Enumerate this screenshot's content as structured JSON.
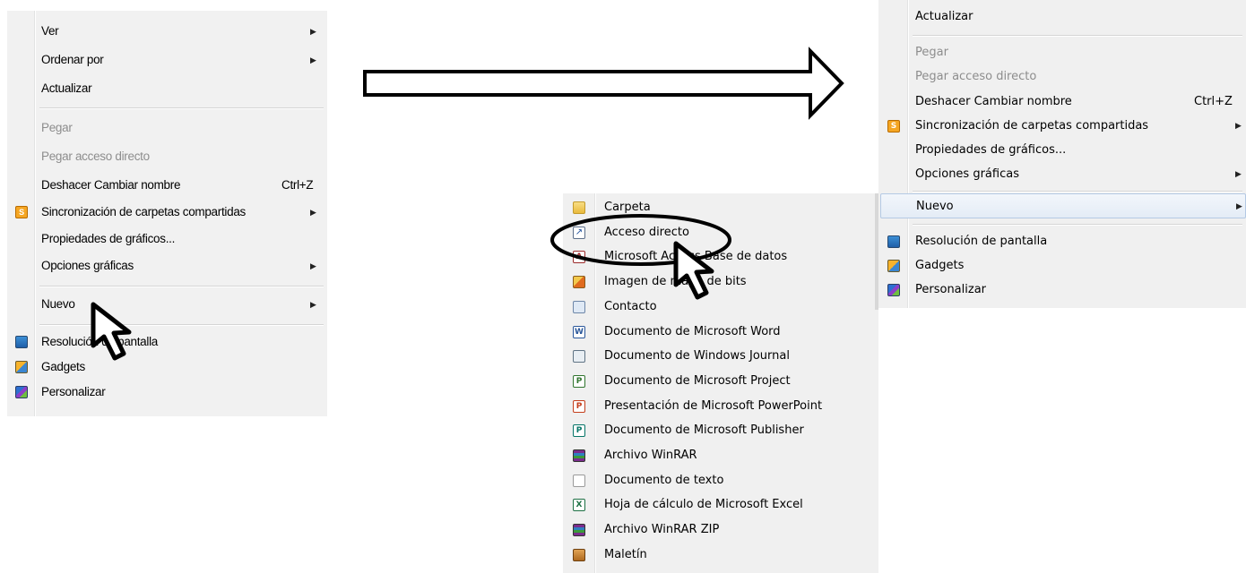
{
  "left_menu": {
    "items": [
      {
        "label": "Ver",
        "submenu": true
      },
      {
        "label": "Ordenar por",
        "submenu": true
      },
      {
        "label": "Actualizar"
      },
      {
        "label": "Pegar",
        "disabled": true
      },
      {
        "label": "Pegar acceso directo",
        "disabled": true
      },
      {
        "label": "Deshacer Cambiar nombre",
        "shortcut": "Ctrl+Z"
      },
      {
        "label": "Sincronización de carpetas compartidas",
        "submenu": true,
        "icon": "sync-icon"
      },
      {
        "label": "Propiedades de gráficos..."
      },
      {
        "label": "Opciones gráficas",
        "submenu": true
      },
      {
        "label": "Nuevo",
        "submenu": true
      },
      {
        "label": "Resolución de pantalla",
        "icon": "screen-resolution-icon"
      },
      {
        "label": "Gadgets",
        "icon": "gadgets-icon"
      },
      {
        "label": "Personalizar",
        "icon": "personalize-icon"
      }
    ]
  },
  "right_menu": {
    "items": [
      {
        "label": "Actualizar"
      },
      {
        "label": "Pegar",
        "disabled": true
      },
      {
        "label": "Pegar acceso directo",
        "disabled": true
      },
      {
        "label": "Deshacer Cambiar nombre",
        "shortcut": "Ctrl+Z"
      },
      {
        "label": "Sincronización de carpetas compartidas",
        "submenu": true,
        "icon": "sync-icon"
      },
      {
        "label": "Propiedades de gráficos..."
      },
      {
        "label": "Opciones gráficas",
        "submenu": true
      },
      {
        "label": "Nuevo",
        "submenu": true,
        "highlighted": true
      },
      {
        "label": "Resolución de pantalla",
        "icon": "screen-resolution-icon"
      },
      {
        "label": "Gadgets",
        "icon": "gadgets-icon"
      },
      {
        "label": "Personalizar",
        "icon": "personalize-icon"
      }
    ]
  },
  "new_submenu": {
    "items": [
      {
        "label": "Carpeta",
        "icon": "folder-icon"
      },
      {
        "label": "Acceso directo",
        "icon": "shortcut-icon",
        "circled": true
      },
      {
        "label": "Microsoft Access Base de datos",
        "icon": "access-icon"
      },
      {
        "label": "Imagen de mapa de bits",
        "icon": "bitmap-icon"
      },
      {
        "label": "Contacto",
        "icon": "contact-icon"
      },
      {
        "label": "Documento de Microsoft Word",
        "icon": "word-icon"
      },
      {
        "label": "Documento de Windows Journal",
        "icon": "journal-icon"
      },
      {
        "label": "Documento de Microsoft Project",
        "icon": "project-icon"
      },
      {
        "label": "Presentación de Microsoft PowerPoint",
        "icon": "powerpoint-icon"
      },
      {
        "label": "Documento de Microsoft Publisher",
        "icon": "publisher-icon"
      },
      {
        "label": "Archivo WinRAR",
        "icon": "winrar-icon"
      },
      {
        "label": "Documento de texto",
        "icon": "text-document-icon"
      },
      {
        "label": "Hoja de cálculo de Microsoft Excel",
        "icon": "excel-icon"
      },
      {
        "label": "Archivo WinRAR ZIP",
        "icon": "winrar-zip-icon"
      },
      {
        "label": "Maletín",
        "icon": "briefcase-icon"
      }
    ]
  },
  "colors": {
    "menu_bg": "#f0f0f0",
    "disabled_text": "#8d8d8d",
    "highlight_border": "#b4c9e4"
  }
}
